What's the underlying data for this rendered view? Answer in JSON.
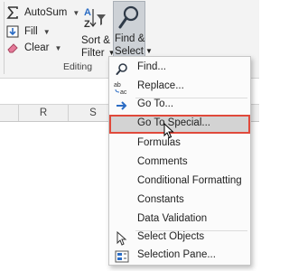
{
  "ribbon": {
    "autosum_label": "AutoSum",
    "fill_label": "Fill",
    "clear_label": "Clear",
    "sort_filter_label_line1": "Sort &",
    "sort_filter_label_line2": "Filter",
    "find_select_label_line1": "Find &",
    "find_select_label_line2": "Select",
    "group_label": "Editing"
  },
  "sheet": {
    "columns": [
      "R",
      "S"
    ]
  },
  "menu": {
    "items": [
      {
        "label": "Find...",
        "icon": "search-icon"
      },
      {
        "label": "Replace...",
        "icon": "replace-icon"
      },
      {
        "label": "Go To...",
        "icon": "arrow-right-icon"
      },
      {
        "label": "Go To Special...",
        "icon": "",
        "highlighted": true
      },
      {
        "label": "Formulas",
        "icon": ""
      },
      {
        "label": "Comments",
        "icon": ""
      },
      {
        "label": "Conditional Formatting",
        "icon": ""
      },
      {
        "label": "Constants",
        "icon": ""
      },
      {
        "label": "Data Validation",
        "icon": ""
      },
      {
        "label": "Select Objects",
        "icon": "pointer-icon"
      },
      {
        "label": "Selection Pane...",
        "icon": "selection-pane-icon"
      }
    ]
  },
  "colors": {
    "highlight_border": "#e0493b",
    "find_button_bg": "#cdd1d6",
    "arrow_blue": "#2b6cc4"
  }
}
